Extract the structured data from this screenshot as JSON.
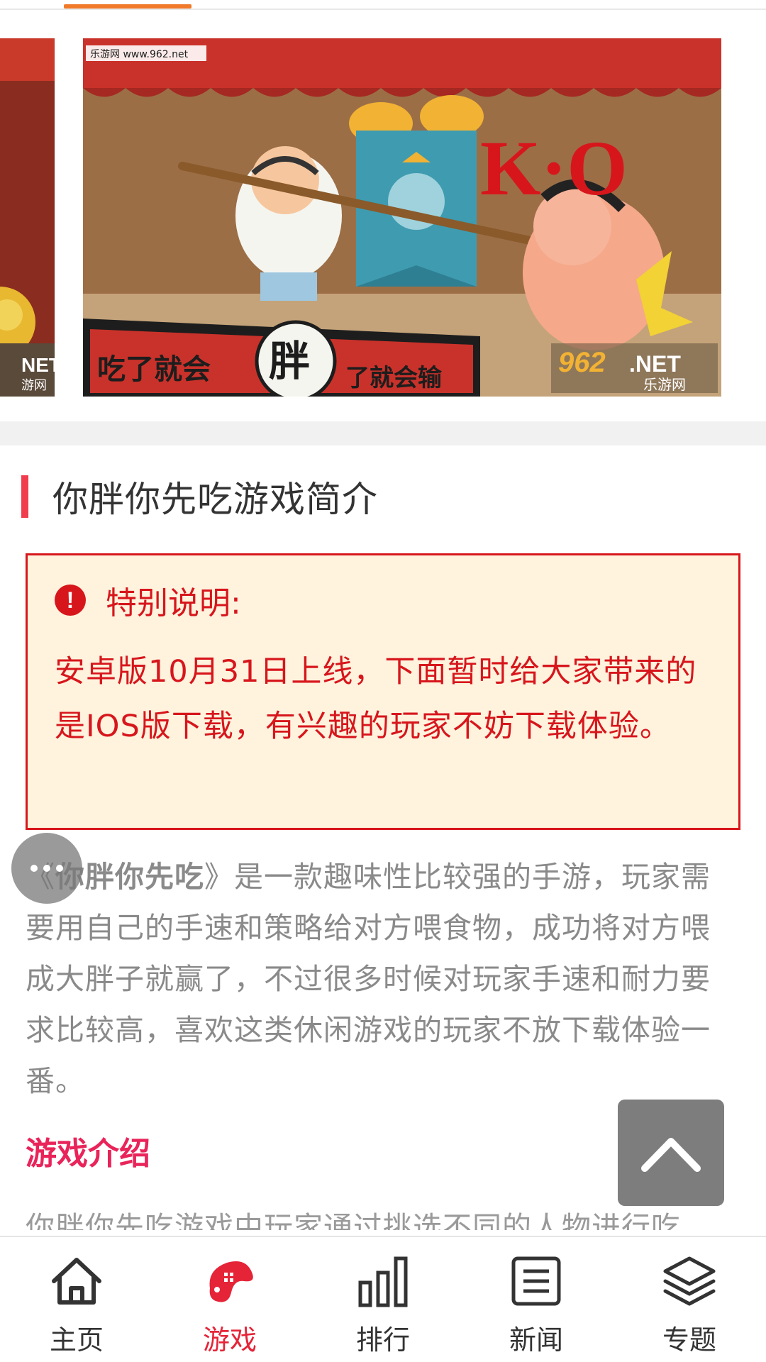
{
  "carousel": {
    "watermark_top": "乐游网 www.962.net",
    "banner_text_left": "吃了就会",
    "banner_text_mid": "胖",
    "banner_text_right": "了就会输",
    "ko_text": "K·O",
    "logo_number": "962",
    "logo_net": ".NET",
    "logo_brand": "乐游网",
    "prev_logo_net": "NET",
    "prev_logo_brand": "游网"
  },
  "intro": {
    "title": "你胖你先吃游戏简介"
  },
  "notice": {
    "icon_glyph": "!",
    "label": "特别说明:",
    "body": "安卓版10月31日上线，下面暂时给大家带来的是IOS版下载，有兴趣的玩家不妨下载体验。"
  },
  "description": {
    "open_quote": "《",
    "game_name": "你胖你先吃",
    "rest": "》是一款趣味性比较强的手游，玩家需要用自己的手速和策略给对方喂食物，成功将对方喂成大胖子就赢了，不过很多时候对玩家手速和耐力要求比较高，喜欢这类休闲游戏的玩家不放下载体验一番。"
  },
  "game_intro": {
    "title": "游戏介绍",
    "first_line": "你胖你先吃游戏中玩家通过挑选不同的人物进行吃"
  },
  "nav": {
    "items": [
      {
        "label": "主页",
        "icon": "home-icon"
      },
      {
        "label": "游戏",
        "icon": "gamepad-icon"
      },
      {
        "label": "排行",
        "icon": "bar-chart-icon"
      },
      {
        "label": "新闻",
        "icon": "news-icon"
      },
      {
        "label": "专题",
        "icon": "layers-icon"
      }
    ],
    "active_index": 1
  },
  "colors": {
    "accent_red": "#d7161c",
    "nav_active": "#e52438",
    "tab_indicator": "#f07a2a",
    "subtitle_pink": "#e9245a"
  }
}
